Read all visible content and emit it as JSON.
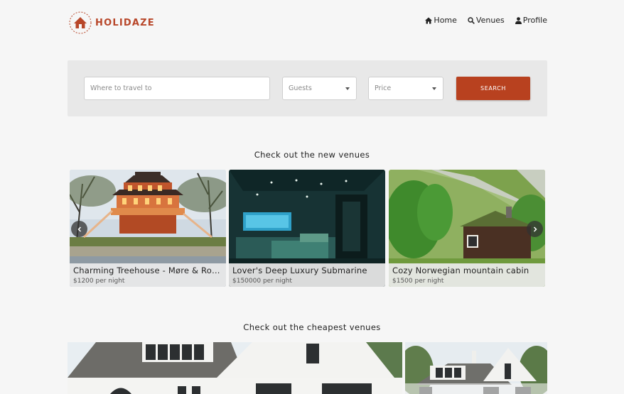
{
  "header": {
    "logo_text": "HOLIDAZE",
    "nav": [
      {
        "label": "Home",
        "icon": "home-icon"
      },
      {
        "label": "Venues",
        "icon": "search-icon"
      },
      {
        "label": "Profile",
        "icon": "user-icon"
      }
    ]
  },
  "search": {
    "where_placeholder": "Where to travel to",
    "guests_placeholder": "Guests",
    "price_placeholder": "Price",
    "button_label": "SEARCH"
  },
  "sections": {
    "new_title": "Check out the new venues",
    "cheapest_title": "Check out the cheapest venues"
  },
  "new_venues": [
    {
      "title": "Charming Treehouse - Møre & Romsdal",
      "price": "$1200 per night"
    },
    {
      "title": "Lover's Deep Luxury Submarine",
      "price": "$150000 per night"
    },
    {
      "title": "Cozy Norwegian mountain cabin",
      "price": "$1500 per night"
    }
  ],
  "colors": {
    "brand": "#b8472a",
    "search_button": "#b8411f",
    "panel": "#e8e8e8",
    "background": "#f6f6f6"
  }
}
